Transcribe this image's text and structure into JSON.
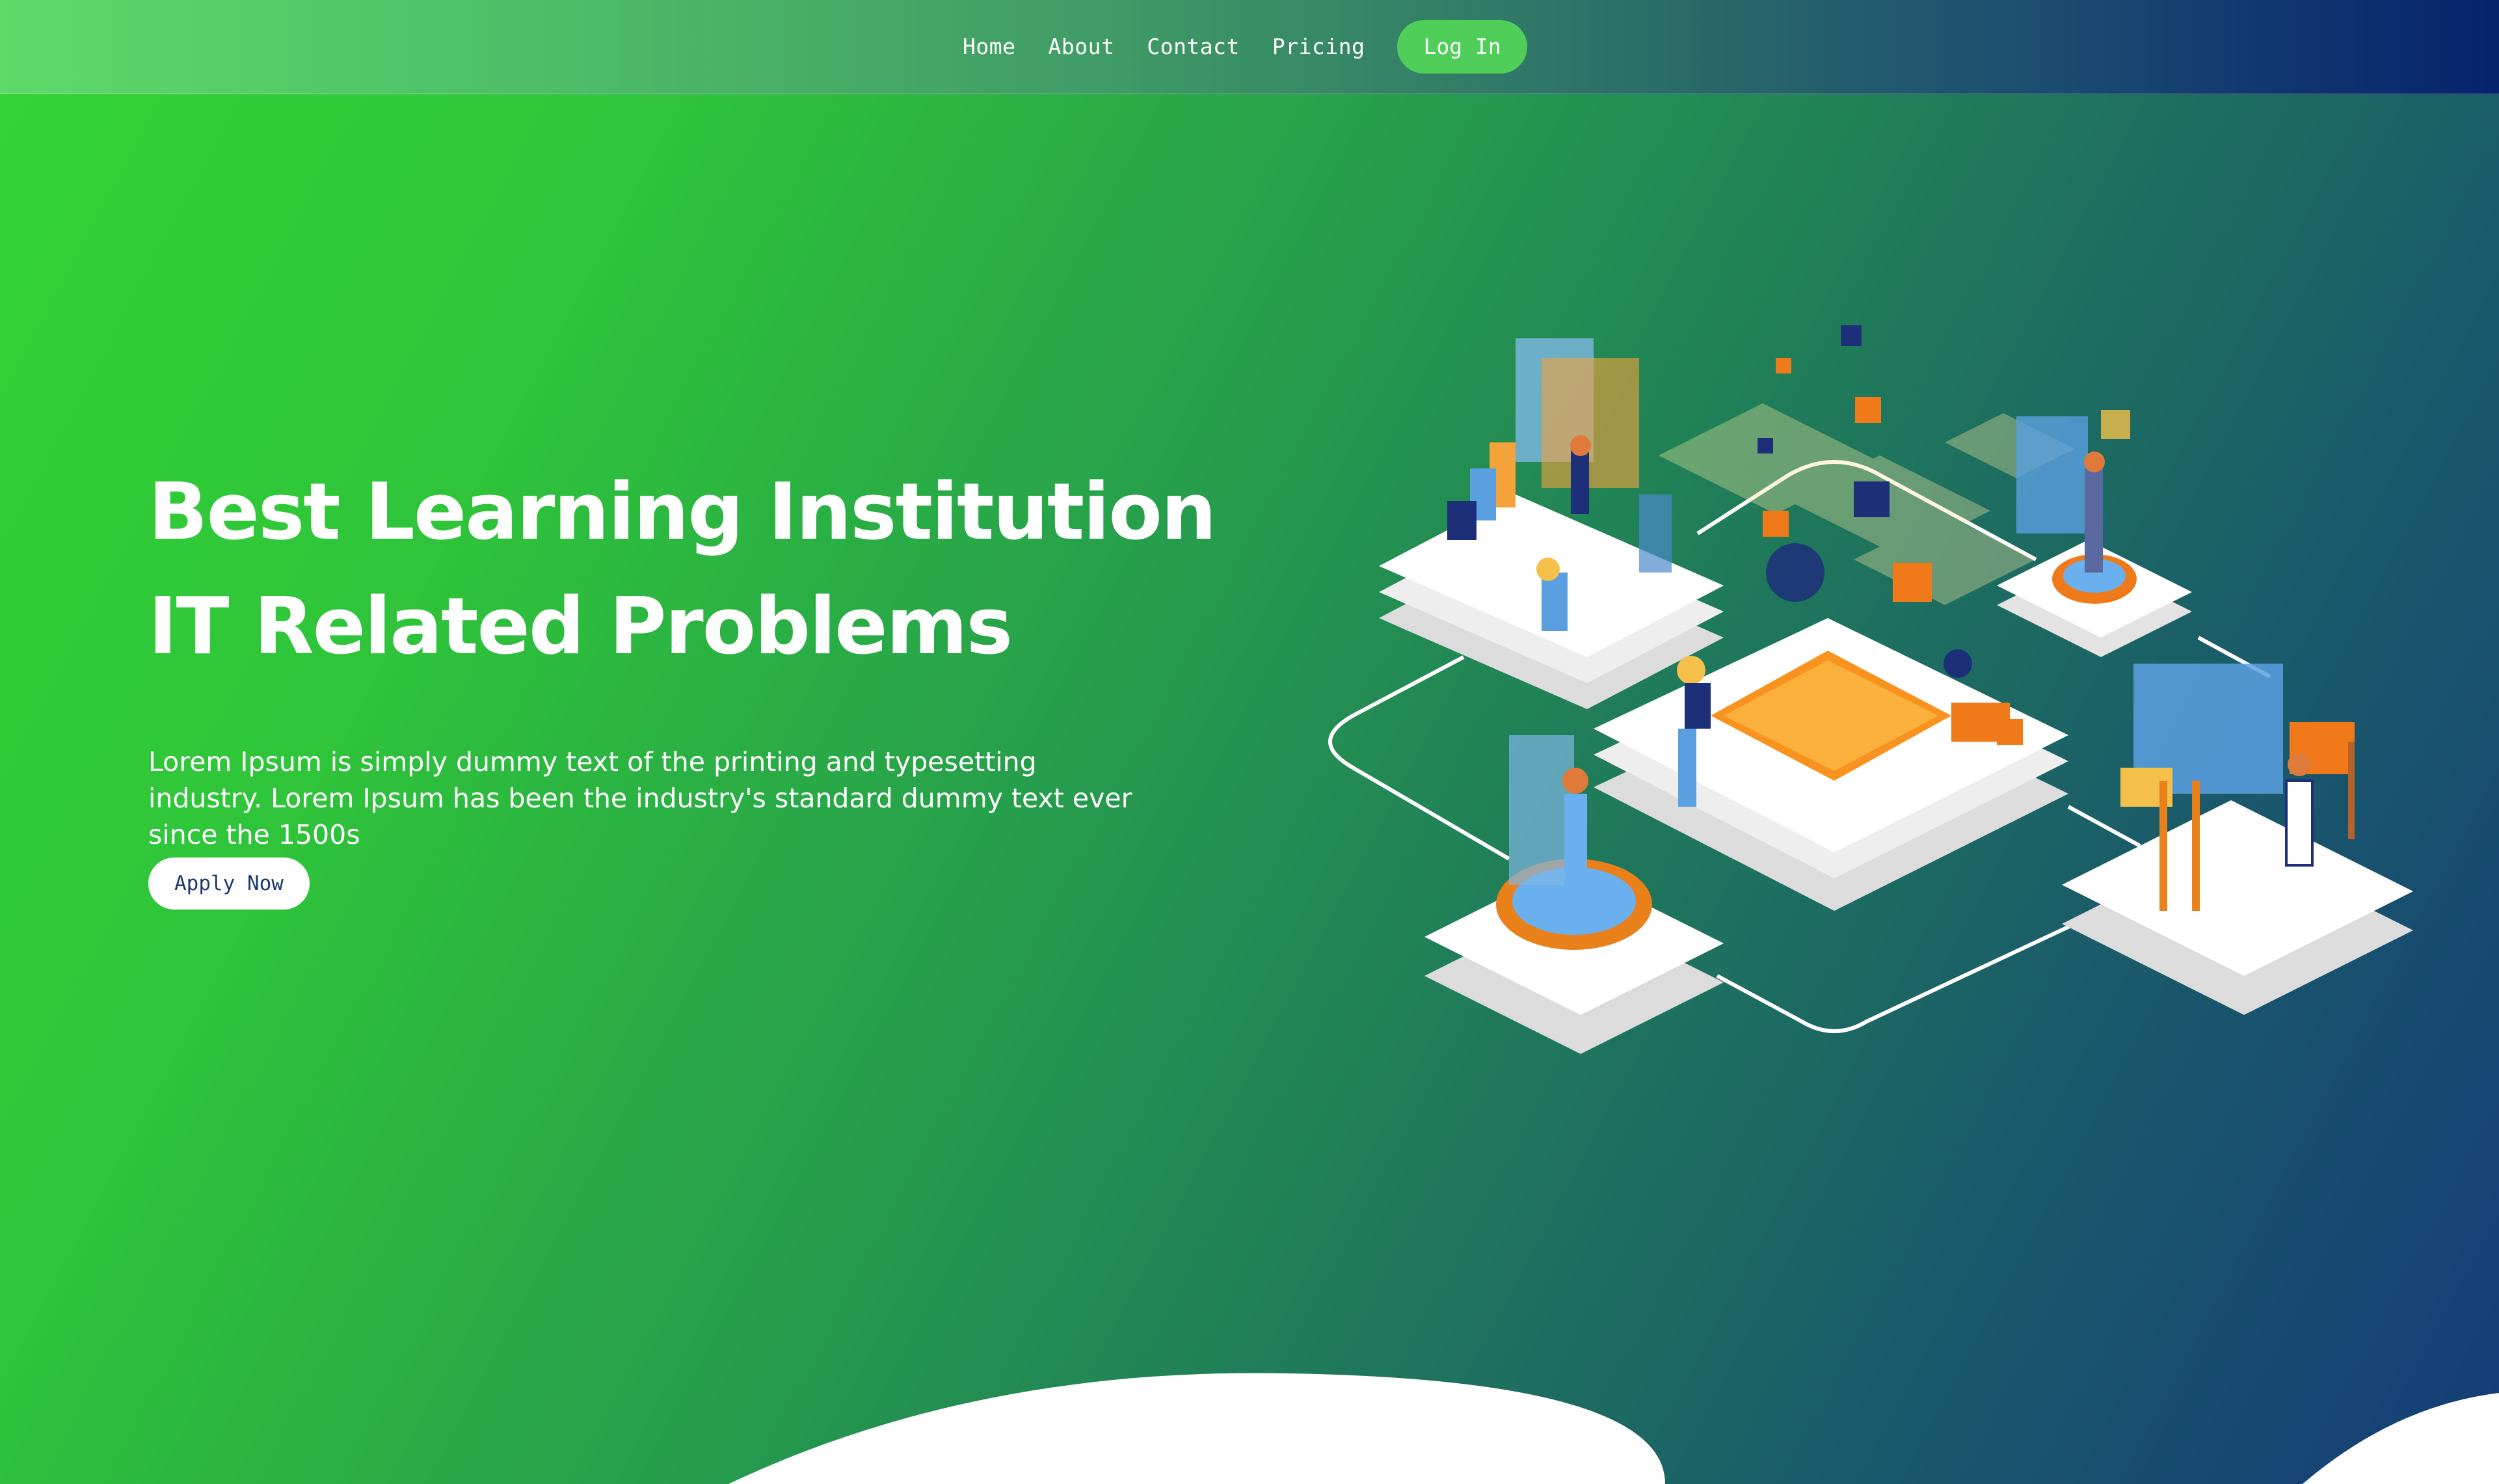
{
  "nav": {
    "links": [
      "Home",
      "About",
      "Contact",
      "Pricing"
    ],
    "login_label": "Log In"
  },
  "hero": {
    "headline_line1": "Best Learning Institution",
    "headline_line2": "IT Related Problems",
    "description": "Lorem Ipsum is simply dummy text of the printing and typesetting industry. Lorem Ipsum has been the industry's standard dummy text ever since the 1500s",
    "cta_label": "Apply Now"
  },
  "colors": {
    "gradient_start": "#33d336",
    "gradient_end": "#143c78",
    "login_button": "#4fcf5a",
    "accent_orange": "#f7931e",
    "cta_text": "#1a3a6a"
  },
  "illustration": {
    "icon": "isometric-network-illustration"
  }
}
